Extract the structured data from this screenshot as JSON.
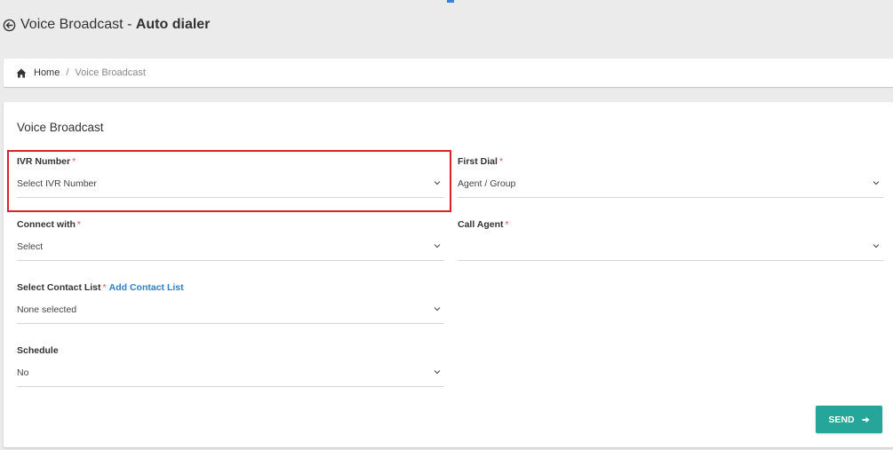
{
  "header": {
    "title_prefix": "Voice Broadcast - ",
    "title_bold": "Auto dialer"
  },
  "breadcrumb": {
    "home": "Home",
    "separator": "/",
    "current": "Voice Broadcast"
  },
  "card": {
    "title": "Voice Broadcast"
  },
  "form": {
    "ivr_number": {
      "label": "IVR Number",
      "required": "*",
      "value": "Select IVR Number"
    },
    "first_dial": {
      "label": "First Dial",
      "required": "*",
      "value": "Agent / Group"
    },
    "connect_with": {
      "label": "Connect with",
      "required": "*",
      "value": "Select"
    },
    "call_agent": {
      "label": "Call Agent",
      "required": "*",
      "value": ""
    },
    "contact_list": {
      "label": "Select Contact List",
      "required": "*",
      "link": "Add Contact List",
      "value": "None selected"
    },
    "schedule": {
      "label": "Schedule",
      "value": "No"
    }
  },
  "actions": {
    "send_label": "SEND"
  },
  "colors": {
    "accent": "#26a69a",
    "link": "#2f7ec9",
    "required": "#e25555",
    "highlight": "#d9222a"
  },
  "icons": {
    "back": "arrow-circle-left-icon",
    "home": "home-icon",
    "chevron": "chevron-down-icon",
    "send": "arrow-right-icon"
  }
}
